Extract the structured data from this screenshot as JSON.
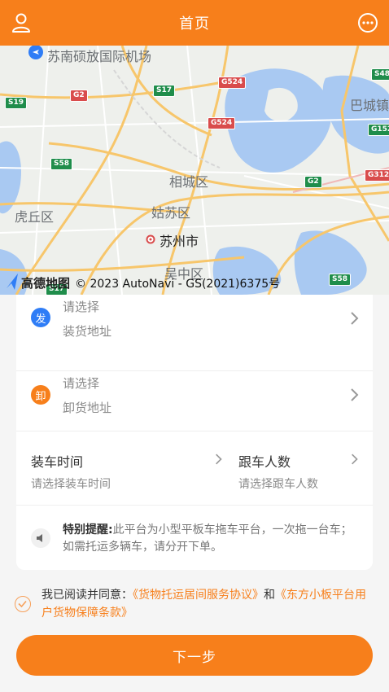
{
  "header": {
    "title": "首页",
    "left_icon": "user-icon",
    "right_icon": "more-icon"
  },
  "map": {
    "labels": {
      "airport": "苏南硕放国际机场",
      "xiangcheng": "相城区",
      "huqiu": "虎丘区",
      "gusu": "姑苏区",
      "suzhou": "苏州市",
      "wuzhong": "吴中区",
      "bacheng": "巴城镇"
    },
    "shields": {
      "s19": "S19",
      "g2a": "G2",
      "s17a": "S17",
      "g524a": "G524",
      "s48": "S48",
      "g524b": "G524",
      "g152": "G152",
      "s58a": "S58",
      "g2b": "G2",
      "g312": "G312",
      "s17b": "S17",
      "s58b": "S58"
    },
    "brand": "高德地图",
    "copyright": "© 2023 AutoNavi - GS(2021)6375号"
  },
  "form": {
    "load": {
      "badge": "发",
      "line1": "请选择",
      "line2": "装货地址"
    },
    "unload": {
      "badge": "卸",
      "line1": "请选择",
      "line2": "卸货地址"
    },
    "load_time": {
      "title": "装车时间",
      "placeholder": "请选择装车时间"
    },
    "riders": {
      "title": "跟车人数",
      "placeholder": "请选择跟车人数"
    },
    "notice": {
      "label": "特别提醒:",
      "text": "此平台为小型平板车拖车平台，一次拖一台车；如需托运多辆车，请分开下单。"
    }
  },
  "agreement": {
    "prefix": "我已阅读并同意：",
    "link1": "《货物托运居间服务协议》",
    "conj": "和",
    "link2": "《东方小板平台用户货物保障条款》"
  },
  "button": {
    "next": "下一步"
  },
  "colors": {
    "brand_orange": "#f77f1b",
    "badge_blue": "#2f7df6"
  }
}
